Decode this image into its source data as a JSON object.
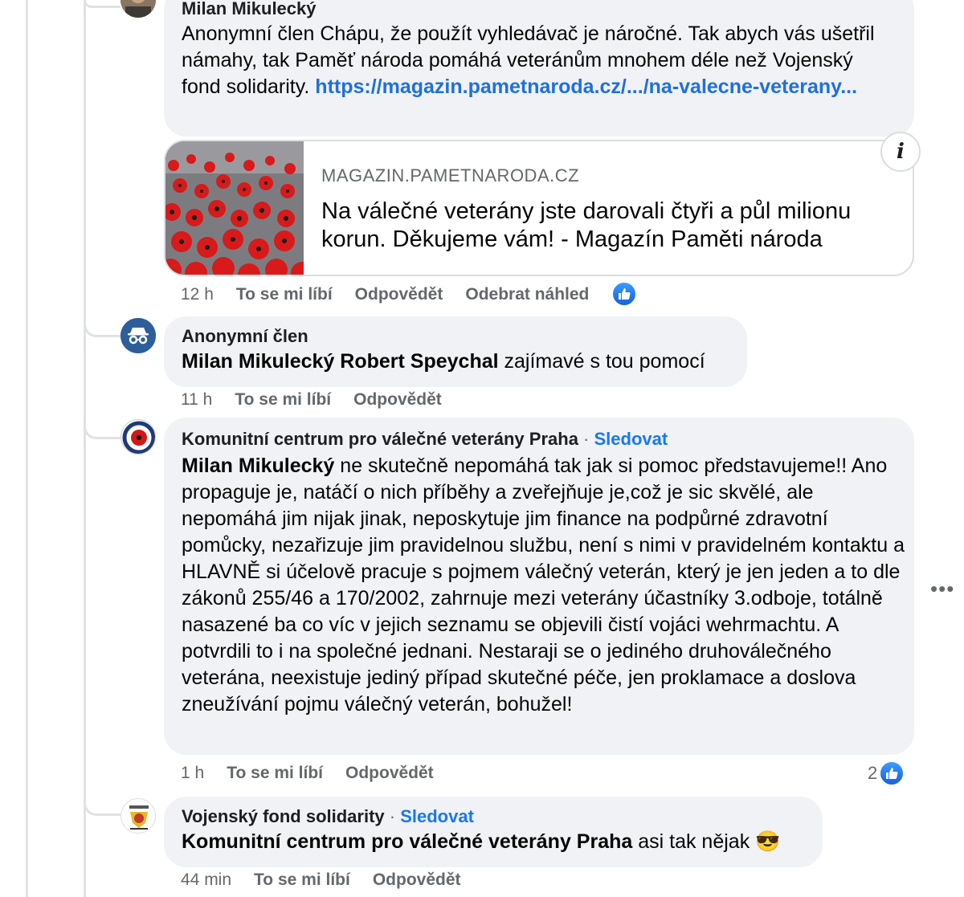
{
  "comments": [
    {
      "author": "Milan Mikulecký",
      "text_mention": "Anonymní člen",
      "text_body": " Chápu, že použít vyhledávač je náročné. Tak abych vás ušetřil námahy, tak Paměť národa pomáhá veteránům mnohem déle než Vojenský fond solidarity. ",
      "link_text": "https://magazin.pametnaroda.cz/.../na-valecne-veterany...",
      "preview": {
        "domain": "MAGAZIN.PAMETNARODA.CZ",
        "title": "Na válečné veterány jste darovali čtyři a půl milionu korun. Děkujeme vám! - Magazín Paměti národa",
        "info_label": "i"
      },
      "time": "12 h",
      "like_label": "To se mi líbí",
      "reply_label": "Odpovědět",
      "remove_preview_label": "Odebrat náhled"
    },
    {
      "author": "Anonymní člen",
      "mention": "Milan Mikulecký Robert Speychal",
      "text_body": " zajímavé s tou pomocí",
      "time": "11 h",
      "like_label": "To se mi líbí",
      "reply_label": "Odpovědět"
    },
    {
      "author": "Komunitní centrum pro válečné veterány Praha",
      "follow_label": "Sledovat",
      "mention": "Milan Mikulecký",
      "text_body": " ne skutečně nepomáhá tak jak si pomoc představujeme!! Ano propaguje je, natáčí o nich příběhy a zveřejňuje je,což je sic skvělé, ale nepomáhá jim nijak jinak, neposkytuje jim finance na podpůrné zdravotní pomůcky, nezařizuje jim pravidelnou službu, není s nimi v pravidelném kontaktu a HLAVNĚ si účelově pracuje s pojmem válečný veterán, který je jen jeden a to dle zákonů 255/46 a 170/2002, zahrnuje mezi veterány účastníky 3.odboje, totálně nasazené ba co víc v jejich seznamu se objevili čistí vojáci wehrmachtu. A potvrdili to i na společné jednani. Nestaraji se o jediného druhoválečného veterána, neexistuje jediný případ skutečné péče, jen proklamace a doslova zneužívání pojmu válečný veterán, bohužel!",
      "time": "1 h",
      "like_label": "To se mi líbí",
      "reply_label": "Odpovědět",
      "like_count": "2"
    },
    {
      "author": "Vojenský fond solidarity",
      "follow_label": "Sledovat",
      "mention": "Komunitní centrum pro válečné veterány Praha",
      "text_body": " asi tak nějak ",
      "emoji": "😎",
      "time": "44 min",
      "like_label": "To se mi líbí",
      "reply_label": "Odpovědět"
    }
  ],
  "more_menu": "•••",
  "colors": {
    "link": "#216fdb",
    "follow": "#1877f2",
    "bubble": "#f0f2f5",
    "meta": "#65676b"
  }
}
